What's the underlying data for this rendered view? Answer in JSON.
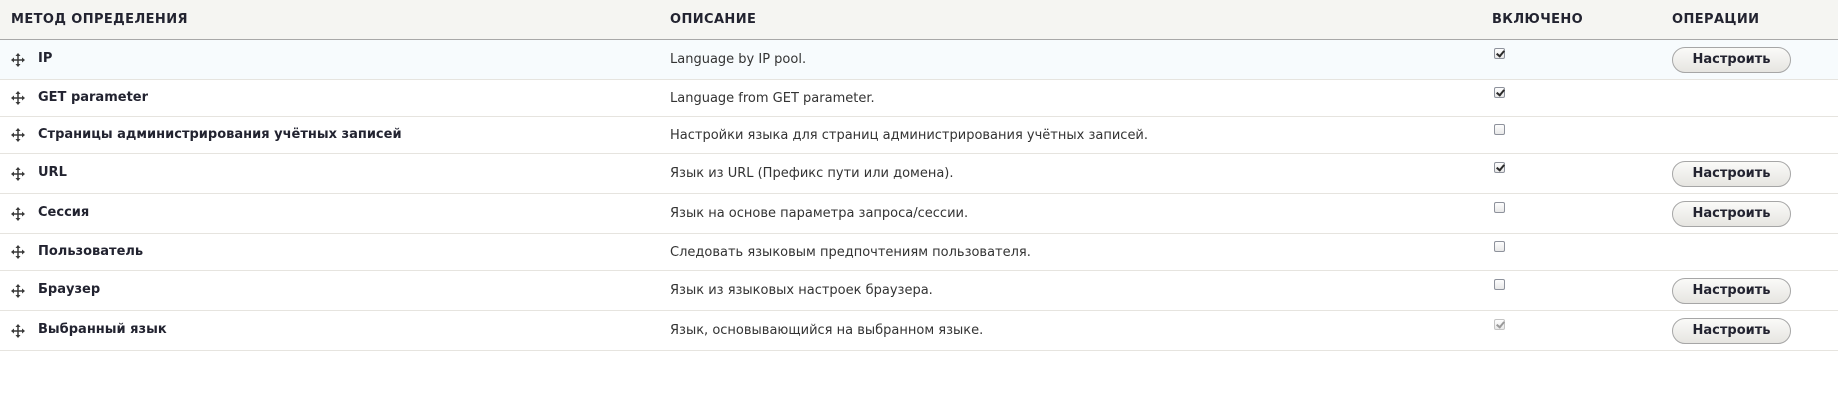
{
  "header": {
    "col_method": "МЕТОД ОПРЕДЕЛЕНИЯ",
    "col_description": "ОПИСАНИЕ",
    "col_enabled": "ВКЛЮЧЕНО",
    "col_operations": "ОПЕРАЦИИ"
  },
  "rows": [
    {
      "label": "IP",
      "description": "Language by IP pool.",
      "enabled": true,
      "disabled": false,
      "button": "Настроить"
    },
    {
      "label": "GET parameter",
      "description": "Language from GET parameter.",
      "enabled": true,
      "disabled": false,
      "button": ""
    },
    {
      "label": "Страницы администрирования учётных записей",
      "description": "Настройки языка для страниц администрирования учётных записей.",
      "enabled": false,
      "disabled": false,
      "button": ""
    },
    {
      "label": "URL",
      "description": "Язык из URL (Префикс пути или домена).",
      "enabled": true,
      "disabled": false,
      "button": "Настроить"
    },
    {
      "label": "Сессия",
      "description": "Язык на основе параметра запроса/сессии.",
      "enabled": false,
      "disabled": false,
      "button": "Настроить"
    },
    {
      "label": "Пользователь",
      "description": "Следовать языковым предпочтениям пользователя.",
      "enabled": false,
      "disabled": false,
      "button": ""
    },
    {
      "label": "Браузер",
      "description": "Язык из языковых настроек браузера.",
      "enabled": false,
      "disabled": false,
      "button": "Настроить"
    },
    {
      "label": "Выбранный язык",
      "description": "Язык, основывающийся на выбранном языке.",
      "enabled": true,
      "disabled": true,
      "button": "Настроить"
    }
  ]
}
